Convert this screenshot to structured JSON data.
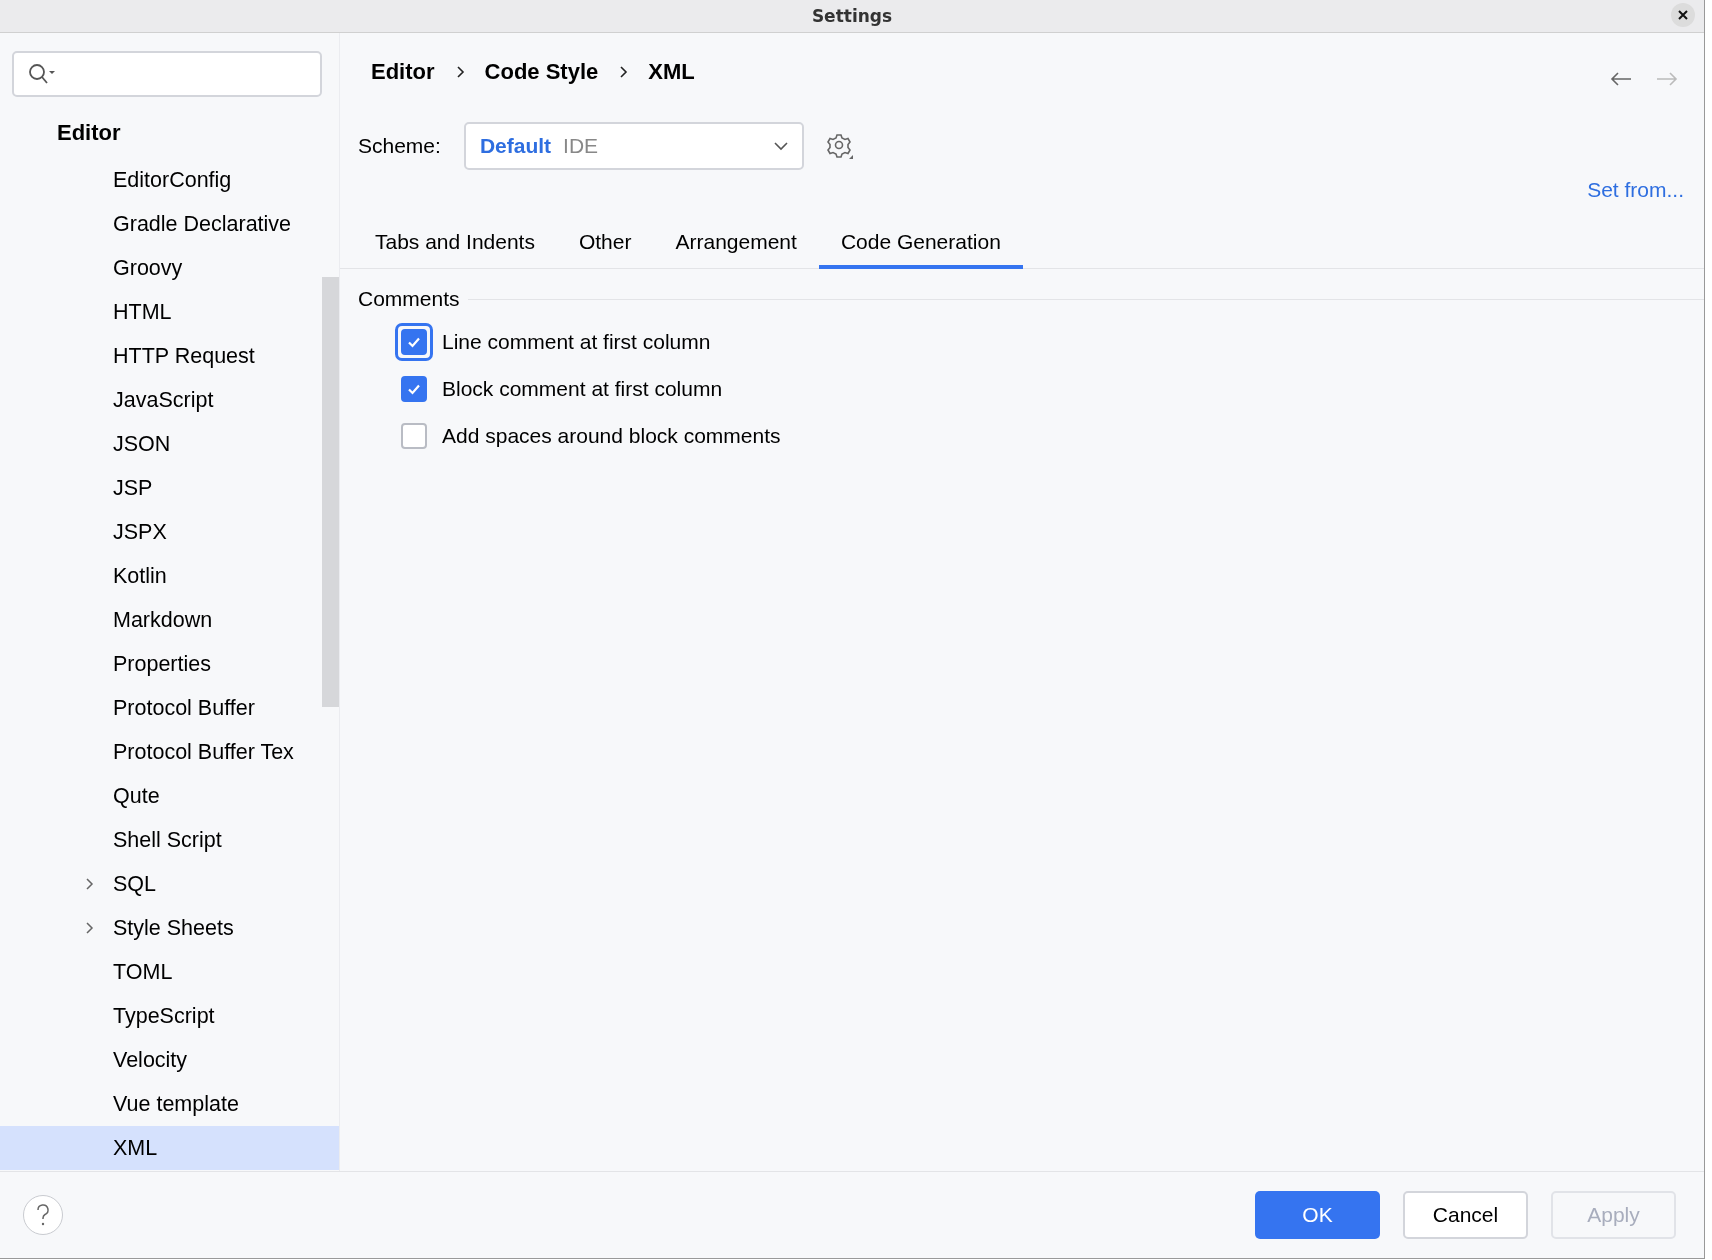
{
  "window": {
    "title": "Settings"
  },
  "sidebar": {
    "section": "Editor",
    "items": [
      {
        "label": "EditorConfig",
        "selected": false
      },
      {
        "label": "Gradle Declarative",
        "selected": false
      },
      {
        "label": "Groovy",
        "selected": false
      },
      {
        "label": "HTML",
        "selected": false
      },
      {
        "label": "HTTP Request",
        "selected": false
      },
      {
        "label": "JavaScript",
        "selected": false
      },
      {
        "label": "JSON",
        "selected": false
      },
      {
        "label": "JSP",
        "selected": false
      },
      {
        "label": "JSPX",
        "selected": false
      },
      {
        "label": "Kotlin",
        "selected": false
      },
      {
        "label": "Markdown",
        "selected": false
      },
      {
        "label": "Properties",
        "selected": false
      },
      {
        "label": "Protocol Buffer",
        "selected": false
      },
      {
        "label": "Protocol Buffer Tex",
        "selected": false
      },
      {
        "label": "Qute",
        "selected": false
      },
      {
        "label": "Shell Script",
        "selected": false
      },
      {
        "label": "SQL",
        "selected": false,
        "expanded": false
      },
      {
        "label": "Style Sheets",
        "selected": false,
        "expanded": false
      },
      {
        "label": "TOML",
        "selected": false
      },
      {
        "label": "TypeScript",
        "selected": false
      },
      {
        "label": "Velocity",
        "selected": false
      },
      {
        "label": "Vue template",
        "selected": false
      },
      {
        "label": "XML",
        "selected": true
      }
    ]
  },
  "breadcrumbs": [
    "Editor",
    "Code Style",
    "XML"
  ],
  "scheme": {
    "label": "Scheme:",
    "name": "Default",
    "kind": "IDE"
  },
  "set_from": "Set from...",
  "tabs": [
    {
      "label": "Tabs and Indents",
      "selected": false
    },
    {
      "label": "Other",
      "selected": false
    },
    {
      "label": "Arrangement",
      "selected": false
    },
    {
      "label": "Code Generation",
      "selected": true
    }
  ],
  "group": {
    "title": "Comments",
    "options": [
      {
        "label": "Line comment at first column",
        "checked": true,
        "focused": true
      },
      {
        "label": "Block comment at first column",
        "checked": true,
        "focused": false
      },
      {
        "label": "Add spaces around block comments",
        "checked": false,
        "focused": false
      }
    ]
  },
  "buttons": [
    {
      "label": "OK",
      "kind": "primary",
      "disabled": false
    },
    {
      "label": "Cancel",
      "kind": "normal",
      "disabled": false
    },
    {
      "label": "Apply",
      "kind": "normal",
      "disabled": true
    }
  ]
}
